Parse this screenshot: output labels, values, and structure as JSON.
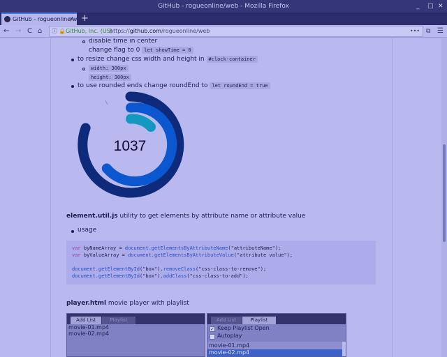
{
  "window": {
    "title": "GitHub - rogueonline/web - Mozilla Firefox",
    "controls": [
      "_",
      "□",
      "✕"
    ]
  },
  "tab": {
    "label": "GitHub - rogueonline/w",
    "close": "✕",
    "new_tab": "+"
  },
  "nav": {
    "back": "←",
    "forward": "→",
    "reload": "C",
    "home": "⌂",
    "info": "ⓘ",
    "lock": "🔒",
    "ev_cert": "GitHub, Inc. (US)",
    "url_prefix": "https://",
    "url_host": "github.com",
    "url_path": "/rogueonline/web",
    "page_actions": "•••",
    "menu": "☰"
  },
  "content": {
    "sub1": "disable time in center",
    "sub1b": "change flag to 0",
    "sub1b_code": "let showTime = 0",
    "item_resize": "to resize change css width and height in",
    "item_resize_code": "#clock-container",
    "width_code": "width: 300px",
    "height_code": "height: 300px",
    "item_round": "to use rounded ends change roundEnd to",
    "item_round_code": "let roundEnd = true",
    "clock_value": "1037",
    "element_title": "element.util.js",
    "element_desc": "utility to get elements by attribute name or attribute value",
    "usage": "usage",
    "code": {
      "l1_kw": "var",
      "l1_var": " byNameArray = ",
      "l1_fn": "document.getElementsByAttributeName",
      "l1_arg": "(\"attributeName\");",
      "l2_kw": "var",
      "l2_var": " byValueArray = ",
      "l2_fn": "document.getElementsByAttributeValue",
      "l2_arg": "(\"attribute value\");",
      "l3_fn": "document.getElementById",
      "l3_a": "(\"box\").",
      "l3_m": "removeClass",
      "l3_b": "(\"css-class-to-remove\");",
      "l4_fn": "document.getElementById",
      "l4_a": "(\"box\").",
      "l4_m": "addClass",
      "l4_b": "(\"css-class-to-add\");"
    },
    "player_title": "player.html",
    "player_desc": "movie player with playlist"
  },
  "player_left": {
    "tabs": [
      "Add List",
      "Playlist"
    ],
    "files": [
      "movie-01.mp4",
      "movie-02.mp4"
    ]
  },
  "player_right": {
    "tabs": [
      "Add List",
      "Playlist"
    ],
    "keep_open": "Keep Playlist Open",
    "keep_open_checked": true,
    "autoplay": "Autoplay",
    "autoplay_checked": false,
    "files": [
      "movie-01.mp4",
      "movie-02.mp4"
    ]
  },
  "colors": {
    "ring_outer": "#0e2a7a",
    "ring_mid": "#0b57d0",
    "ring_inner": "#1598c0"
  }
}
